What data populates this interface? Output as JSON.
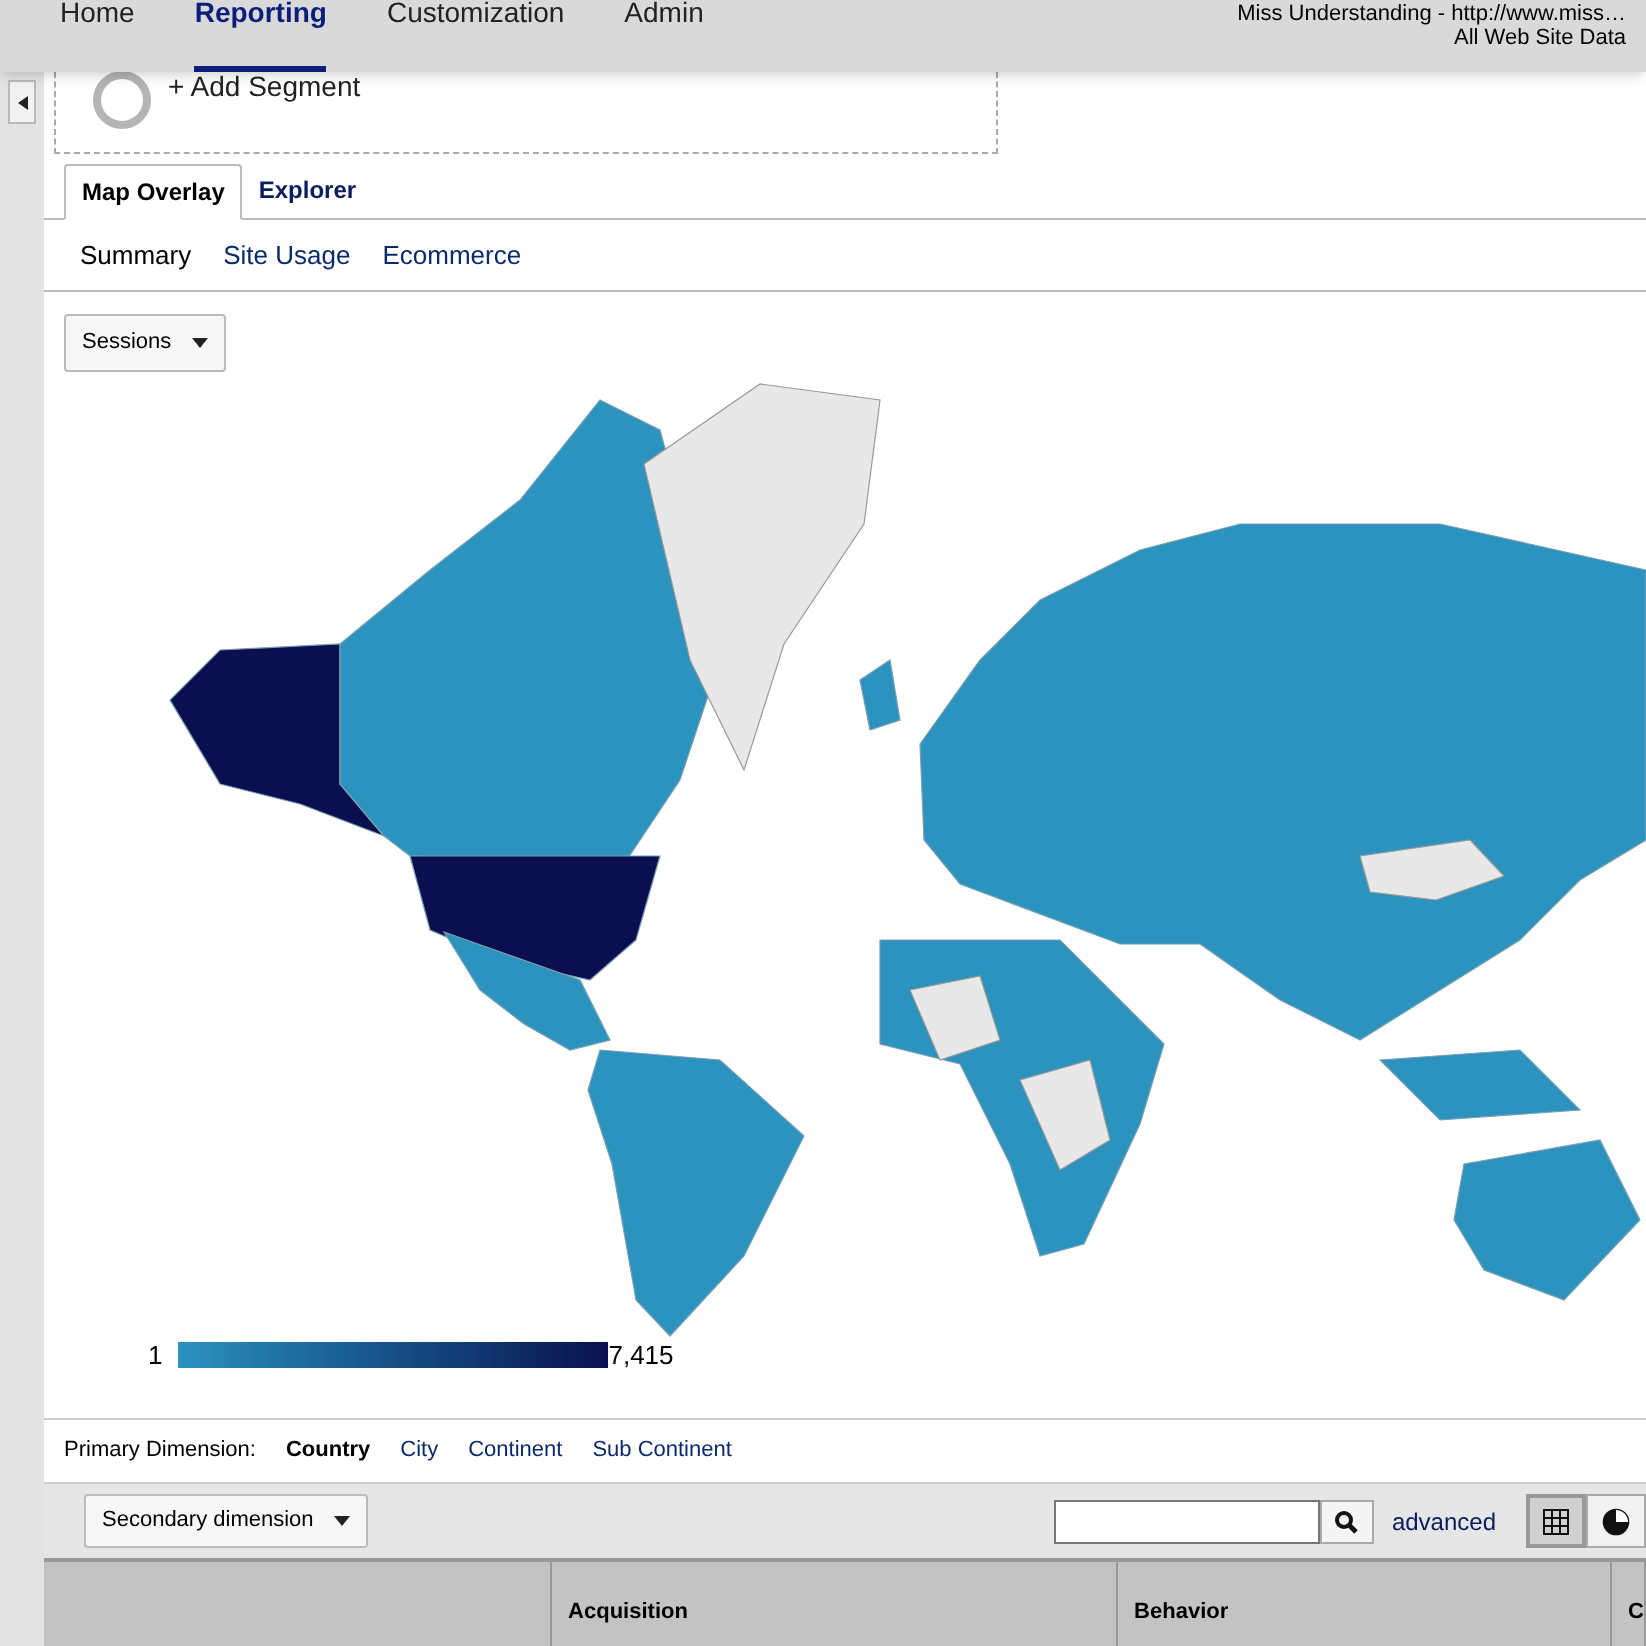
{
  "nav": {
    "items": [
      {
        "label": "Home",
        "selected": false
      },
      {
        "label": "Reporting",
        "selected": true
      },
      {
        "label": "Customization",
        "selected": false
      },
      {
        "label": "Admin",
        "selected": false
      }
    ],
    "account": "Miss Understanding - http://www.miss…",
    "property": "All Web Site Data"
  },
  "segment": {
    "label": "+ Add Segment"
  },
  "tabs": [
    {
      "label": "Map Overlay",
      "selected": true
    },
    {
      "label": "Explorer",
      "selected": false
    }
  ],
  "subtabs": [
    {
      "label": "Summary",
      "selected": true
    },
    {
      "label": "Site Usage",
      "selected": false
    },
    {
      "label": "Ecommerce",
      "selected": false
    }
  ],
  "metric_dropdown": {
    "label": "Sessions"
  },
  "map": {
    "legend_min": "1",
    "legend_max": "7,415"
  },
  "primary_dimension": {
    "label": "Primary Dimension:",
    "options": [
      {
        "label": "Country",
        "selected": true
      },
      {
        "label": "City",
        "selected": false
      },
      {
        "label": "Continent",
        "selected": false
      },
      {
        "label": "Sub Continent",
        "selected": false
      }
    ]
  },
  "toolbar": {
    "secondary_dimension": "Secondary dimension",
    "advanced": "advanced",
    "views": [
      {
        "kind": "table",
        "selected": true
      },
      {
        "kind": "pie",
        "selected": false
      }
    ]
  },
  "table": {
    "column_groups": [
      "Acquisition",
      "Behavior",
      "C"
    ]
  }
}
